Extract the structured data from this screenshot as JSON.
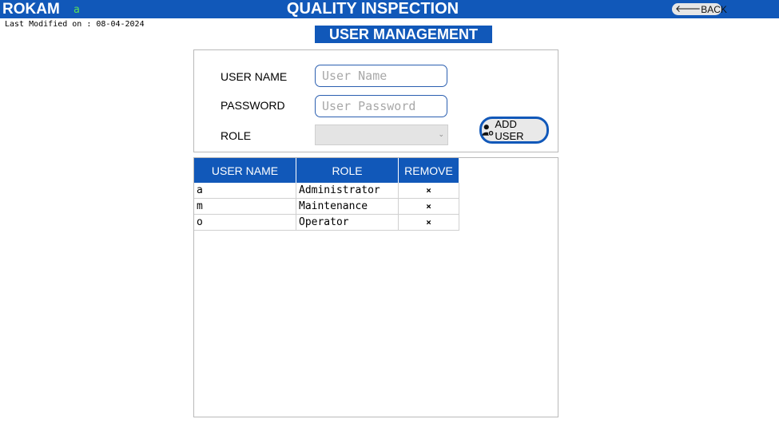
{
  "header": {
    "brand": "ROKAM",
    "current_user": "a",
    "title": "QUALITY INSPECTION",
    "back_label": "BACK",
    "back_icon": "arrow-left-icon"
  },
  "last_modified": "Last Modified on : 08-04-2024",
  "section_title": "USER MANAGEMENT",
  "form": {
    "username_label": "USER NAME",
    "username_placeholder": "User Name",
    "password_label": "PASSWORD",
    "password_placeholder": "User Password",
    "role_label": "ROLE",
    "role_value": "",
    "add_button_label": "ADD USER",
    "add_button_icon": "add-user-icon"
  },
  "table": {
    "headers": [
      "USER NAME",
      "ROLE",
      "REMOVE"
    ],
    "rows": [
      {
        "username": "a",
        "role": "Administrator",
        "remove": "×"
      },
      {
        "username": "m",
        "role": "Maintenance",
        "remove": "×"
      },
      {
        "username": "o",
        "role": "Operator",
        "remove": "×"
      }
    ]
  },
  "colors": {
    "primary": "#1158b9",
    "user_indicator": "#59e05a"
  }
}
